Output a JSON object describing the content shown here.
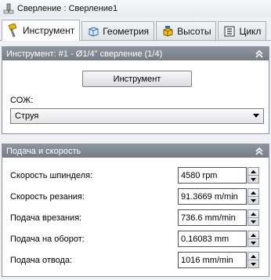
{
  "title": "Сверление : Сверление1",
  "tabs": [
    {
      "label": "Инструмент",
      "icon": "drill-tool-icon",
      "active": true
    },
    {
      "label": "Геометрия",
      "icon": "geometry-cube-icon",
      "active": false
    },
    {
      "label": "Высоты",
      "icon": "heights-cube-icon",
      "active": false
    },
    {
      "label": "Цикл",
      "icon": "cycle-list-icon",
      "active": false
    }
  ],
  "tool_panel": {
    "header": "Инструмент: #1 - Ø1/4\" сверление (1/4)",
    "tool_button": "Инструмент",
    "coolant_label": "СОЖ:",
    "coolant_value": "Струя"
  },
  "feed_panel": {
    "header": "Подача и скорость",
    "rows": [
      {
        "label": "Скорость шпинделя:",
        "value": "4580 rpm"
      },
      {
        "label": "Скорость резания:",
        "value": "91.3669 m/min"
      },
      {
        "label": "Подача врезания:",
        "value": "736.6 mm/min"
      },
      {
        "label": "Подача на оборот:",
        "value": "0.16083 mm"
      },
      {
        "label": "Подача отвода:",
        "value": "1016 mm/min"
      }
    ]
  },
  "colors": {
    "header_bg": "#7d838c",
    "accent_blue": "#2f6db5",
    "tool_yellow": "#e8b400"
  }
}
